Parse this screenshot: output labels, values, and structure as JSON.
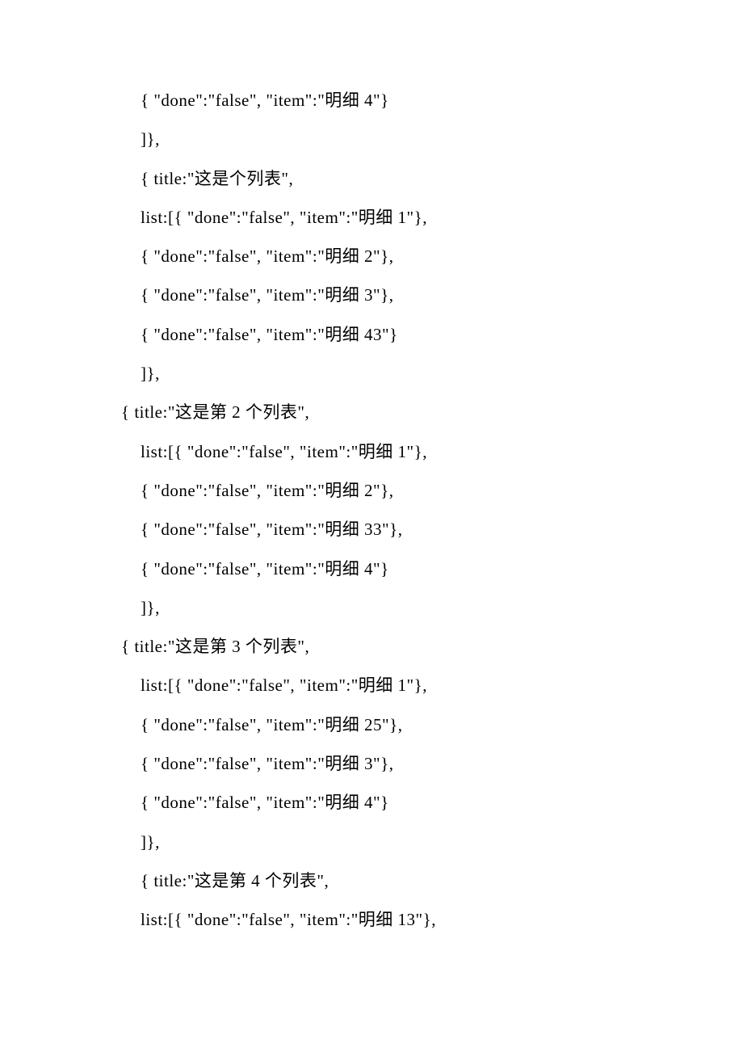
{
  "lines": [
    {
      "indent": 1,
      "text": "{ \"done\":\"false\", \"item\":\"明细 4\"}"
    },
    {
      "indent": 1,
      "text": "]},"
    },
    {
      "indent": 1,
      "text": "{ title:\"这是个列表\","
    },
    {
      "indent": 1,
      "text": "list:[{ \"done\":\"false\", \"item\":\"明细 1\"},"
    },
    {
      "indent": 1,
      "text": "{ \"done\":\"false\", \"item\":\"明细 2\"},"
    },
    {
      "indent": 1,
      "text": "{ \"done\":\"false\", \"item\":\"明细 3\"},"
    },
    {
      "indent": 1,
      "text": "{ \"done\":\"false\", \"item\":\"明细 43\"}"
    },
    {
      "indent": 1,
      "text": "]},"
    },
    {
      "indent": 0,
      "text": "{ title:\"这是第 2 个列表\","
    },
    {
      "indent": 1,
      "text": "list:[{ \"done\":\"false\", \"item\":\"明细 1\"},"
    },
    {
      "indent": 1,
      "text": "{ \"done\":\"false\", \"item\":\"明细 2\"},"
    },
    {
      "indent": 1,
      "text": "{ \"done\":\"false\", \"item\":\"明细 33\"},"
    },
    {
      "indent": 1,
      "text": "{ \"done\":\"false\", \"item\":\"明细 4\"}"
    },
    {
      "indent": 1,
      "text": "]},"
    },
    {
      "indent": 0,
      "text": "{ title:\"这是第 3 个列表\","
    },
    {
      "indent": 1,
      "text": "list:[{ \"done\":\"false\", \"item\":\"明细 1\"},"
    },
    {
      "indent": 1,
      "text": "{ \"done\":\"false\", \"item\":\"明细 25\"},"
    },
    {
      "indent": 1,
      "text": "{ \"done\":\"false\", \"item\":\"明细 3\"},"
    },
    {
      "indent": 1,
      "text": "{ \"done\":\"false\", \"item\":\"明细 4\"}"
    },
    {
      "indent": 1,
      "text": "]},"
    },
    {
      "indent": 1,
      "text": "{ title:\"这是第 4 个列表\","
    },
    {
      "indent": 1,
      "text": "list:[{ \"done\":\"false\", \"item\":\"明细 13\"},"
    }
  ]
}
